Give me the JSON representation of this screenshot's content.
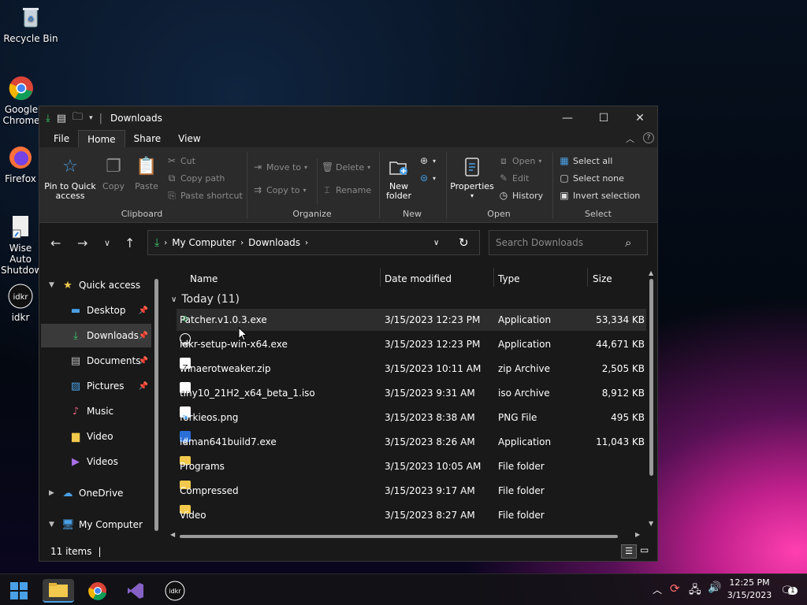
{
  "desktop": {
    "icons": [
      {
        "label": "Recycle Bin",
        "icon": "recycle-bin-icon"
      },
      {
        "label": "Google Chrome",
        "icon": "chrome-icon"
      },
      {
        "label": "Firefox",
        "icon": "firefox-icon"
      },
      {
        "label": "Wise Auto Shutdown",
        "icon": "shortcut-icon"
      },
      {
        "label": "idkr",
        "icon": "idkr-icon"
      }
    ]
  },
  "window": {
    "title": "Downloads",
    "controls": {
      "minimize": "—",
      "maximize": "☐",
      "close": "✕"
    }
  },
  "ribbon": {
    "tabs": [
      "File",
      "Home",
      "Share",
      "View"
    ],
    "active_tab": "Home",
    "clipboard": {
      "pin_label": "Pin to Quick access",
      "copy_label": "Copy",
      "paste_label": "Paste",
      "cut_label": "Cut",
      "copy_path_label": "Copy path",
      "paste_shortcut_label": "Paste shortcut",
      "group_label": "Clipboard"
    },
    "organize": {
      "move_to_label": "Move to",
      "copy_to_label": "Copy to",
      "delete_label": "Delete",
      "rename_label": "Rename",
      "group_label": "Organize"
    },
    "new": {
      "new_folder_label": "New folder",
      "group_label": "New"
    },
    "open": {
      "properties_label": "Properties",
      "open_label": "Open",
      "edit_label": "Edit",
      "history_label": "History",
      "group_label": "Open"
    },
    "select": {
      "select_all_label": "Select all",
      "select_none_label": "Select none",
      "invert_label": "Invert selection",
      "group_label": "Select"
    }
  },
  "address": {
    "segments": [
      "My Computer",
      "Downloads"
    ],
    "search_placeholder": "Search Downloads"
  },
  "navpane": {
    "quick_access": "Quick access",
    "items": [
      {
        "label": "Desktop",
        "pinned": true
      },
      {
        "label": "Downloads",
        "pinned": true,
        "selected": true
      },
      {
        "label": "Documents",
        "pinned": true
      },
      {
        "label": "Pictures",
        "pinned": true
      },
      {
        "label": "Music",
        "pinned": false
      },
      {
        "label": "Video",
        "pinned": false
      },
      {
        "label": "Videos",
        "pinned": false
      }
    ],
    "onedrive": "OneDrive",
    "my_computer": "My Computer"
  },
  "files": {
    "columns": [
      "Name",
      "Date modified",
      "Type",
      "Size"
    ],
    "group_label": "Today (11)",
    "rows": [
      {
        "name": "Patcher.v1.0.3.exe",
        "date": "3/15/2023 12:23 PM",
        "type": "Application",
        "size": "53,334 KB"
      },
      {
        "name": "idkr-setup-win-x64.exe",
        "date": "3/15/2023 12:23 PM",
        "type": "Application",
        "size": "44,671 KB"
      },
      {
        "name": "winaerotweaker.zip",
        "date": "3/15/2023 10:11 AM",
        "type": "zip Archive",
        "size": "2,505 KB"
      },
      {
        "name": "tiny10_21H2_x64_beta_1.iso",
        "date": "3/15/2023 9:31 AM",
        "type": "iso Archive",
        "size": "8,912 KB"
      },
      {
        "name": "forkieos.png",
        "date": "3/15/2023 8:38 AM",
        "type": "PNG File",
        "size": "495 KB"
      },
      {
        "name": "idman641build7.exe",
        "date": "3/15/2023 8:26 AM",
        "type": "Application",
        "size": "11,043 KB"
      },
      {
        "name": "Programs",
        "date": "3/15/2023 10:05 AM",
        "type": "File folder",
        "size": ""
      },
      {
        "name": "Compressed",
        "date": "3/15/2023 9:17 AM",
        "type": "File folder",
        "size": ""
      },
      {
        "name": "Video",
        "date": "3/15/2023 8:27 AM",
        "type": "File folder",
        "size": ""
      }
    ]
  },
  "status": {
    "item_count": "11 items"
  },
  "taskbar": {
    "time": "12:25 PM",
    "date": "3/15/2023",
    "notification_count": "1"
  },
  "colors": {
    "accent": "#4aa0e6",
    "folder": "#f2c94c",
    "selection": "#3a3a3a"
  }
}
